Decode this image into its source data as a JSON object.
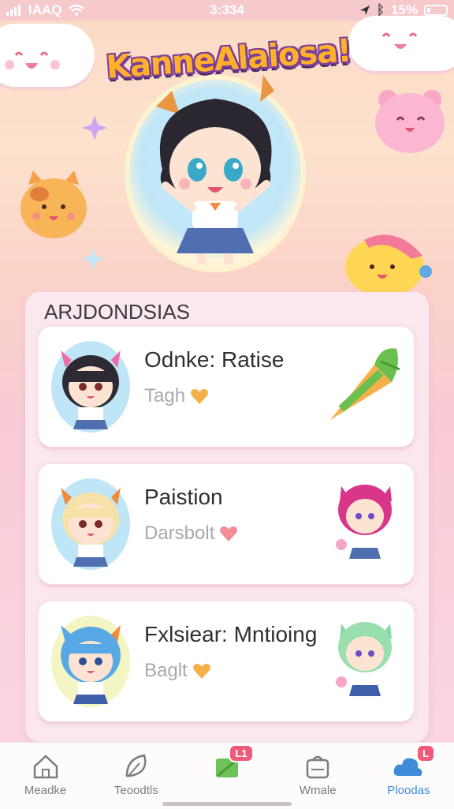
{
  "status_bar": {
    "left_text": "IAAQ",
    "time": "3:334",
    "battery": "15%"
  },
  "app": {
    "title": "KanneAlaiosa!"
  },
  "list": {
    "heading": "ARJDONDSIAS",
    "items": [
      {
        "name": "Odnke: Ratise",
        "subtitle": "Tagh",
        "heart_color": "#f6b04a",
        "hair": "#2d2a33",
        "side": "carrot"
      },
      {
        "name": "Paistion",
        "subtitle": "Darsbolt",
        "heart_color": "#f28c96",
        "hair": "#f6e2a8",
        "side": "pink-chibi"
      },
      {
        "name": "Fxlsiear: Mntioing",
        "subtitle": "Baglt",
        "heart_color": "#f6b04a",
        "hair": "#58a8e6",
        "side": "green-chibi"
      }
    ]
  },
  "tab_bar": {
    "tabs": [
      {
        "label": "Meadke",
        "icon": "home-icon"
      },
      {
        "label": "Teoodtls",
        "icon": "leaf-icon"
      },
      {
        "label": "",
        "icon": "gift-icon",
        "badge": "L1"
      },
      {
        "label": "Wmale",
        "icon": "bag-icon"
      },
      {
        "label": "Ploodas",
        "icon": "cloud-icon",
        "badge": "L"
      }
    ],
    "active_color": "#3d8bd9"
  }
}
